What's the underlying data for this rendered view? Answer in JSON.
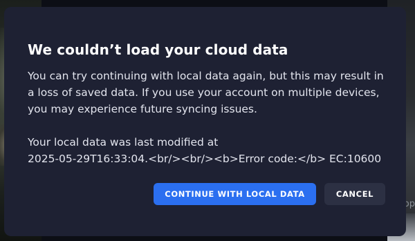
{
  "dialog": {
    "title": "We couldn’t load your cloud data",
    "message": "You can try continuing with local data again, but this may result in a loss of saved data. If you use your account on multiple devices, you may experience future syncing issues.",
    "modified_line": "Your local data was last modified at",
    "error_line": "2025-05-29T16:33:04.<br/><br/><b>Error code:</b> EC:10600",
    "primary_button": "CONTINUE WITH LOCAL DATA",
    "secondary_button": "CANCEL"
  },
  "background": {
    "right_edge_text": "op"
  },
  "colors": {
    "dialog_bg": "#1e2133",
    "primary": "#2b6ff0",
    "secondary": "#2c3043",
    "text": "#e3e5ee"
  }
}
